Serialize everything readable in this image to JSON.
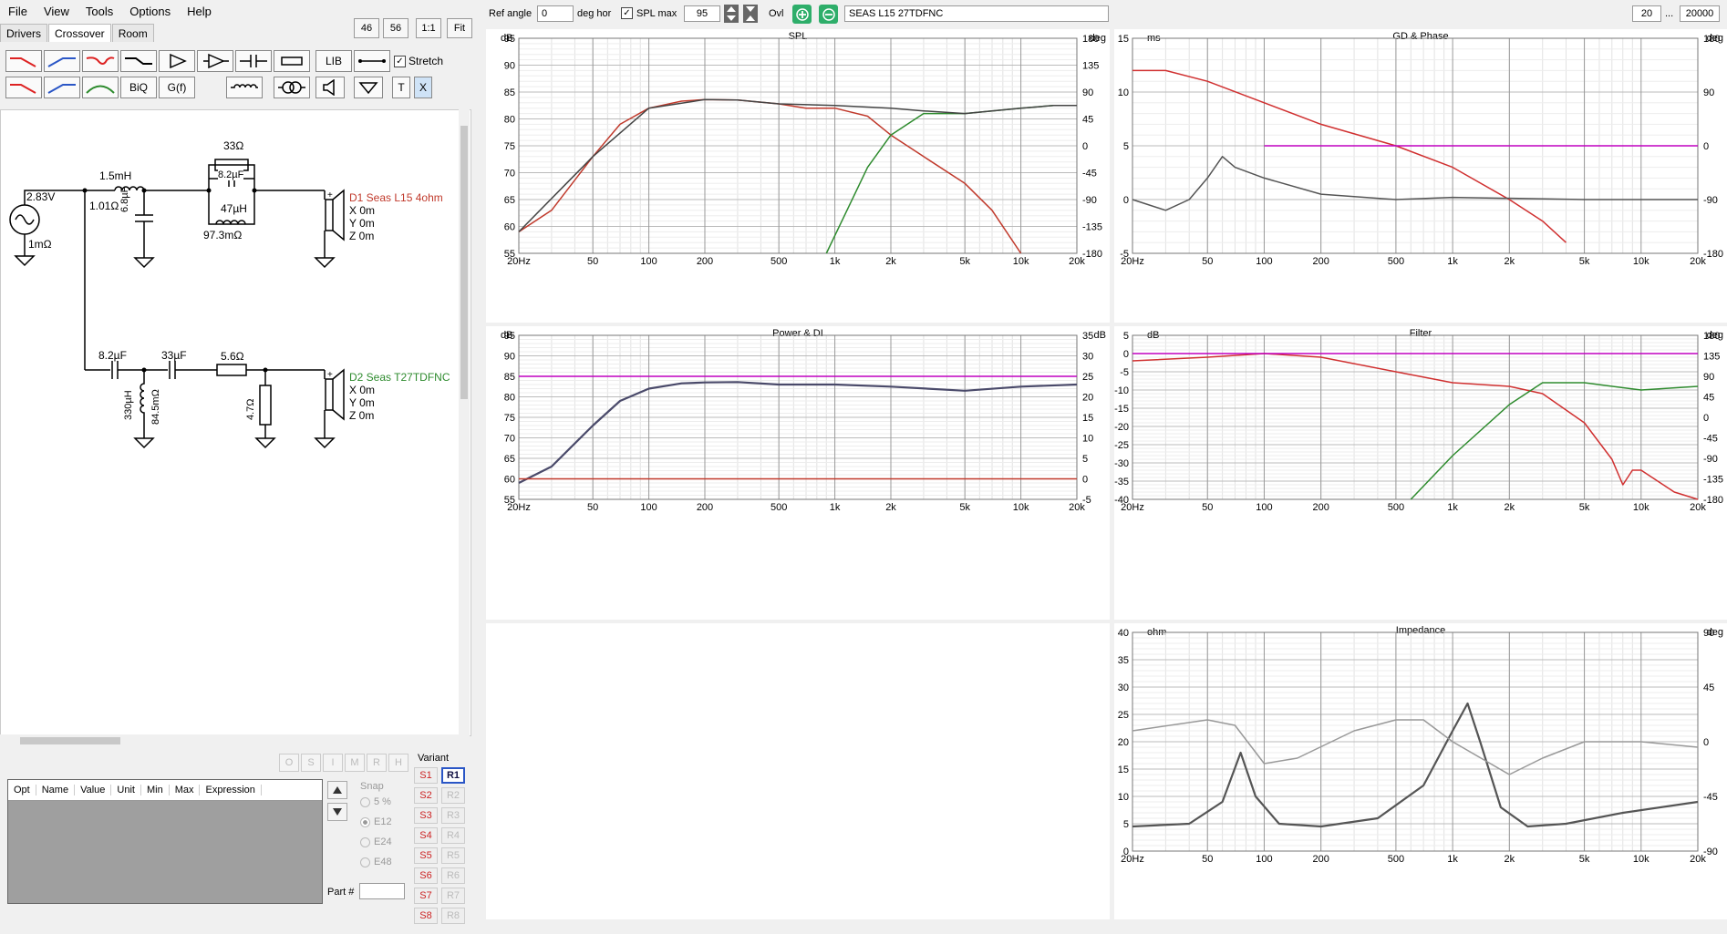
{
  "menu": {
    "file": "File",
    "view": "View",
    "tools": "Tools",
    "options": "Options",
    "help": "Help"
  },
  "tabs": {
    "drivers": "Drivers",
    "crossover": "Crossover",
    "room": "Room"
  },
  "zoom": {
    "z46": "46",
    "z56": "56",
    "z11": "1:1",
    "fit": "Fit"
  },
  "toolbar": {
    "lib": "LIB",
    "biq": "BiQ",
    "gf": "G(f)",
    "stretch": "Stretch",
    "t": "T",
    "x": "X"
  },
  "schematic": {
    "source_v": "2.83V",
    "source_r": "1mΩ",
    "l1": "1.5mH",
    "l1_r": "1.01Ω",
    "c1": "6.8µF",
    "r_top": "33Ω",
    "c_par": "8.2µF",
    "l_par": "47µH",
    "l_par_r": "97.3mΩ",
    "d1_name": "D1 Seas L15 4ohm",
    "d1_x": "X 0m",
    "d1_y": "Y 0m",
    "d1_z": "Z 0m",
    "c2": "8.2µF",
    "c3": "33µF",
    "r2": "5.6Ω",
    "l2": "330µH",
    "l2_r": "84.5mΩ",
    "r3": "4.7Ω",
    "d2_name": "D2 Seas T27TDFNC",
    "d2_x": "X 0m",
    "d2_y": "Y 0m",
    "d2_z": "Z 0m",
    "plus": "+",
    "minus": "−"
  },
  "optimizer": {
    "cols": [
      "Opt",
      "Name",
      "Value",
      "Unit",
      "Min",
      "Max",
      "Expression"
    ],
    "buttons": [
      "O",
      "S",
      "I",
      "M",
      "R",
      "H"
    ],
    "snap": "Snap",
    "snap_opts": [
      "5 %",
      "E12",
      "E24",
      "E48"
    ],
    "part": "Part #"
  },
  "variant": {
    "label": "Variant",
    "s": [
      "S1",
      "S2",
      "S3",
      "S4",
      "S5",
      "S6",
      "S7",
      "S8"
    ],
    "r": [
      "R1",
      "R2",
      "R3",
      "R4",
      "R5",
      "R6",
      "R7",
      "R8"
    ]
  },
  "topbar": {
    "ref_angle_label": "Ref angle",
    "ref_angle": "0",
    "deg_hor": "deg hor",
    "spl_max_label": "SPL max",
    "spl_max": "95",
    "ovl": "Ovl",
    "driver_name": "SEAS L15 27TDFNC",
    "fmin": "20",
    "ellipsis": "...",
    "fmax": "20000"
  },
  "charts": {
    "spl": {
      "title": "SPL",
      "left_unit": "dB",
      "right_unit": "deg",
      "yticks": [
        "95",
        "90",
        "85",
        "80",
        "75",
        "70",
        "65",
        "60",
        "55"
      ],
      "rticks": [
        "180",
        "135",
        "90",
        "45",
        "0",
        "-45",
        "-90",
        "-135",
        "-180"
      ]
    },
    "power": {
      "title": "Power & DI",
      "left_unit": "dB",
      "right_unit": "dB",
      "yticks": [
        "95",
        "90",
        "85",
        "80",
        "75",
        "70",
        "65",
        "60",
        "55"
      ],
      "rticks": [
        "35",
        "30",
        "25",
        "20",
        "15",
        "10",
        "5",
        "0",
        "-5"
      ]
    },
    "gd": {
      "title": "GD & Phase",
      "left_unit": "ms",
      "right_unit": "deg",
      "yticks": [
        "15",
        "10",
        "5",
        "0",
        "-5"
      ],
      "rticks": [
        "180",
        "90",
        "0",
        "-90",
        "-180"
      ]
    },
    "filter": {
      "title": "Filter",
      "left_unit": "dB",
      "right_unit": "deg",
      "yticks": [
        "5",
        "0",
        "-5",
        "-10",
        "-15",
        "-20",
        "-25",
        "-30",
        "-35",
        "-40"
      ],
      "rticks": [
        "180",
        "135",
        "90",
        "45",
        "0",
        "-45",
        "-90",
        "-135",
        "-180"
      ]
    },
    "impedance": {
      "title": "Impedance",
      "left_unit": "ohm",
      "right_unit": "deg",
      "yticks": [
        "40",
        "35",
        "30",
        "25",
        "20",
        "15",
        "10",
        "5",
        "0"
      ],
      "rticks": [
        "90",
        "45",
        "0",
        "-45",
        "-90"
      ]
    },
    "xticks": [
      "20Hz",
      "50",
      "100",
      "200",
      "500",
      "1k",
      "2k",
      "5k",
      "10k",
      "20k"
    ]
  },
  "chart_data": [
    {
      "type": "line",
      "title": "SPL",
      "xlabel": "",
      "ylabel": "dB",
      "ylim": [
        55,
        95
      ],
      "xlim": [
        20,
        20000
      ],
      "xscale": "log",
      "series": [
        {
          "color": "#c0392b",
          "x": [
            20,
            30,
            50,
            70,
            100,
            150,
            200,
            300,
            500,
            700,
            1000,
            1500,
            2000,
            3000,
            5000,
            7000,
            10000
          ],
          "y": [
            59,
            63,
            73,
            79,
            82,
            83.3,
            83.6,
            83.5,
            82.8,
            82,
            82,
            80.5,
            77,
            73,
            68,
            63,
            51
          ]
        },
        {
          "color": "#2e8b2e",
          "x": [
            900,
            1200,
            1500,
            2000,
            3000,
            5000,
            7000,
            10000,
            15000,
            20000
          ],
          "y": [
            55,
            64,
            71,
            77,
            81,
            81,
            81.5,
            82,
            82.5,
            82.5
          ]
        },
        {
          "color": "#444444",
          "x": [
            20,
            50,
            100,
            200,
            300,
            500,
            1000,
            2000,
            3000,
            5000,
            7000,
            10000,
            15000,
            20000
          ],
          "y": [
            59,
            73,
            82,
            83.6,
            83.5,
            82.8,
            82.5,
            82,
            81.5,
            81,
            81.5,
            82,
            82.5,
            82.5
          ]
        }
      ]
    },
    {
      "type": "line",
      "title": "Power & DI",
      "ylabel": "dB",
      "ylim": [
        55,
        95
      ],
      "xlim": [
        20,
        20000
      ],
      "xscale": "log",
      "series": [
        {
          "color": "#4a4a6a",
          "x": [
            20,
            30,
            50,
            70,
            100,
            150,
            200,
            300,
            500,
            1000,
            2000,
            5000,
            10000,
            20000
          ],
          "y": [
            59,
            63,
            73,
            79,
            82,
            83.3,
            83.5,
            83.6,
            83,
            83,
            82.5,
            81.5,
            82.5,
            83
          ]
        },
        {
          "color": "#c000c0",
          "x": [
            20,
            20000
          ],
          "y": [
            85,
            85
          ]
        },
        {
          "color": "#c0392b",
          "x": [
            20,
            20000
          ],
          "y": [
            60,
            60
          ]
        }
      ]
    },
    {
      "type": "line",
      "title": "GD & Phase",
      "ylabel": "ms",
      "ylim": [
        -5,
        15
      ],
      "xlim": [
        20,
        20000
      ],
      "xscale": "log",
      "series": [
        {
          "color": "#d03030",
          "x": [
            20,
            30,
            50,
            100,
            200,
            500,
            1000,
            2000,
            3000,
            4000
          ],
          "y": [
            12,
            12,
            11,
            9,
            7,
            5,
            3,
            0,
            -2,
            -4
          ]
        },
        {
          "color": "#555555",
          "x": [
            20,
            30,
            40,
            50,
            60,
            70,
            100,
            200,
            500,
            1000,
            5000,
            20000
          ],
          "y": [
            0,
            -1,
            0,
            2,
            4,
            3,
            2,
            0.5,
            0,
            0.2,
            0,
            0
          ]
        },
        {
          "color": "#c000c0",
          "x": [
            100,
            20000
          ],
          "y": [
            5,
            5
          ]
        }
      ]
    },
    {
      "type": "line",
      "title": "Filter",
      "ylabel": "dB",
      "ylim": [
        -40,
        5
      ],
      "xlim": [
        20,
        20000
      ],
      "xscale": "log",
      "series": [
        {
          "color": "#d03030",
          "x": [
            20,
            50,
            100,
            200,
            500,
            1000,
            2000,
            3000,
            5000,
            7000,
            8000,
            9000,
            10000,
            15000,
            20000
          ],
          "y": [
            -2,
            -1,
            0,
            -1,
            -5,
            -8,
            -9,
            -11,
            -19,
            -29,
            -36,
            -32,
            -32,
            -38,
            -40
          ]
        },
        {
          "color": "#2e8b2e",
          "x": [
            600,
            1000,
            2000,
            3000,
            5000,
            10000,
            20000
          ],
          "y": [
            -40,
            -28,
            -14,
            -8,
            -8,
            -10,
            -9
          ]
        },
        {
          "color": "#c000c0",
          "x": [
            20,
            20000
          ],
          "y": [
            0,
            0
          ]
        }
      ]
    },
    {
      "type": "line",
      "title": "Impedance",
      "ylabel": "ohm",
      "ylim": [
        0,
        40
      ],
      "xlim": [
        20,
        20000
      ],
      "xscale": "log",
      "series": [
        {
          "color": "#555555",
          "x": [
            20,
            40,
            60,
            75,
            90,
            120,
            200,
            400,
            700,
            1000,
            1200,
            1400,
            1800,
            2500,
            4000,
            8000,
            20000
          ],
          "y": [
            4.5,
            5,
            9,
            18,
            10,
            5,
            4.5,
            6,
            12,
            22,
            27,
            20,
            8,
            4.5,
            5,
            7,
            9
          ]
        },
        {
          "color": "#999999",
          "x": [
            20,
            50,
            70,
            100,
            150,
            300,
            500,
            700,
            1000,
            2000,
            3000,
            5000,
            10000,
            20000
          ],
          "y": [
            22,
            24,
            23,
            16,
            17,
            22,
            24,
            24,
            20,
            14,
            17,
            20,
            20,
            19
          ]
        }
      ]
    }
  ]
}
